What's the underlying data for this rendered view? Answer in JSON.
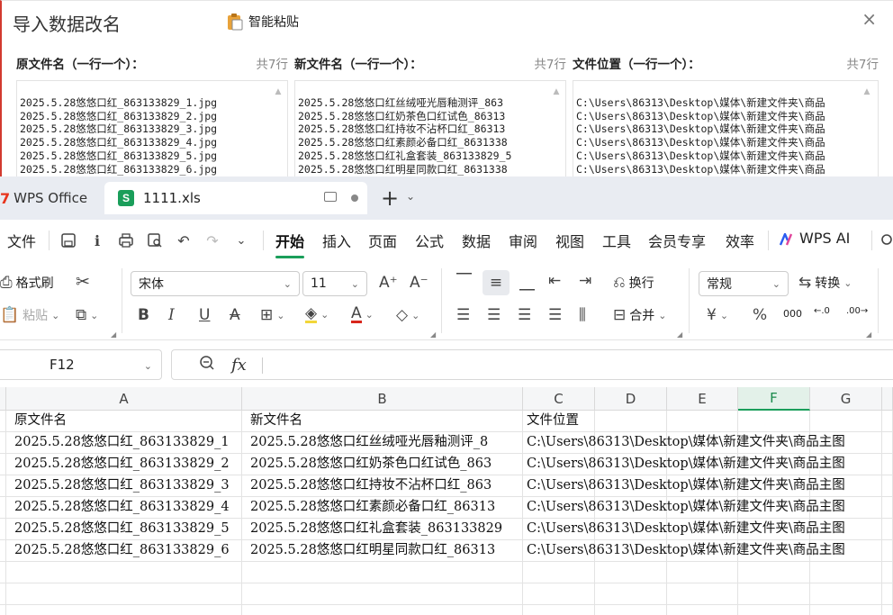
{
  "dialog": {
    "title": "导入数据改名",
    "smart_paste": "智能粘贴",
    "close": "×",
    "columns": [
      {
        "label": "原文件名（一行一个）：",
        "count": "共7行",
        "lines": [
          "2025.5.28悠悠口红_863133829_1.jpg",
          "2025.5.28悠悠口红_863133829_2.jpg",
          "2025.5.28悠悠口红_863133829_3.jpg",
          "2025.5.28悠悠口红_863133829_4.jpg",
          "2025.5.28悠悠口红_863133829_5.jpg",
          "2025.5.28悠悠口红_863133829_6.jpg"
        ]
      },
      {
        "label": "新文件名（一行一个）：",
        "count": "共7行",
        "lines": [
          "2025.5.28悠悠口红丝绒哑光唇釉测评_863",
          "2025.5.28悠悠口红奶茶色口红试色_86313",
          "2025.5.28悠悠口红持妆不沾杯口红_86313",
          "2025.5.28悠悠口红素颜必备口红_8631338",
          "2025.5.28悠悠口红礼盒套装_863133829_5",
          "2025.5.28悠悠口红明星同款口红_8631338"
        ]
      },
      {
        "label": "文件位置（一行一个）：",
        "count": "共7行",
        "lines": [
          "C:\\Users\\86313\\Desktop\\媒体\\新建文件夹\\商品",
          "C:\\Users\\86313\\Desktop\\媒体\\新建文件夹\\商品",
          "C:\\Users\\86313\\Desktop\\媒体\\新建文件夹\\商品",
          "C:\\Users\\86313\\Desktop\\媒体\\新建文件夹\\商品",
          "C:\\Users\\86313\\Desktop\\媒体\\新建文件夹\\商品",
          "C:\\Users\\86313\\Desktop\\媒体\\新建文件夹\\商品"
        ]
      }
    ]
  },
  "tabs": {
    "app_logo": "7",
    "app_name": "WPS Office",
    "doc_badge": "S",
    "doc_name": "1111.xls",
    "new_tab": "+"
  },
  "menu": {
    "file": "文件",
    "items": [
      "开始",
      "插入",
      "页面",
      "公式",
      "数据",
      "审阅",
      "视图",
      "工具",
      "会员专享",
      "效率"
    ],
    "active": "开始",
    "wps_ai": "WPS AI"
  },
  "ribbon": {
    "format_painter": "格式刷",
    "paste": "粘贴",
    "font_name": "宋体",
    "font_size": "11",
    "wrap": "换行",
    "merge": "合并",
    "number_format": "常规",
    "convert": "转换",
    "percent": "%",
    "thousands": "000"
  },
  "formula_bar": {
    "cell_ref": "F12",
    "fx": "fx",
    "content": ""
  },
  "sheet": {
    "columns": [
      "A",
      "B",
      "C",
      "D",
      "E",
      "F",
      "G"
    ],
    "selected_column": "F",
    "rows": [
      [
        "原文件名",
        "新文件名",
        "文件位置",
        "",
        "",
        "",
        ""
      ],
      [
        "2025.5.28悠悠口红_863133829_1",
        "2025.5.28悠悠口红丝绒哑光唇釉测评_8",
        "C:\\Users\\86313\\Desktop\\媒体\\新建文件夹\\商品主图",
        "",
        "",
        "",
        ""
      ],
      [
        "2025.5.28悠悠口红_863133829_2",
        "2025.5.28悠悠口红奶茶色口红试色_863",
        "C:\\Users\\86313\\Desktop\\媒体\\新建文件夹\\商品主图",
        "",
        "",
        "",
        ""
      ],
      [
        "2025.5.28悠悠口红_863133829_3",
        "2025.5.28悠悠口红持妆不沾杯口红_863",
        "C:\\Users\\86313\\Desktop\\媒体\\新建文件夹\\商品主图",
        "",
        "",
        "",
        ""
      ],
      [
        "2025.5.28悠悠口红_863133829_4",
        "2025.5.28悠悠口红素颜必备口红_86313",
        "C:\\Users\\86313\\Desktop\\媒体\\新建文件夹\\商品主图",
        "",
        "",
        "",
        ""
      ],
      [
        "2025.5.28悠悠口红_863133829_5",
        "2025.5.28悠悠口红礼盒套装_863133829",
        "C:\\Users\\86313\\Desktop\\媒体\\新建文件夹\\商品主图",
        "",
        "",
        "",
        ""
      ],
      [
        "2025.5.28悠悠口红_863133829_6",
        "2025.5.28悠悠口红明星同款口红_86313",
        "C:\\Users\\86313\\Desktop\\媒体\\新建文件夹\\商品主图",
        "",
        "",
        "",
        ""
      ],
      [
        "",
        "",
        "",
        "",
        "",
        "",
        ""
      ],
      [
        "",
        "",
        "",
        "",
        "",
        "",
        ""
      ],
      [
        "",
        "",
        "",
        "",
        "",
        "",
        ""
      ]
    ]
  },
  "colors": {
    "accent": "#1a9e5a",
    "wps_red": "#e8341c",
    "dialog_border": "#d23a2f"
  }
}
